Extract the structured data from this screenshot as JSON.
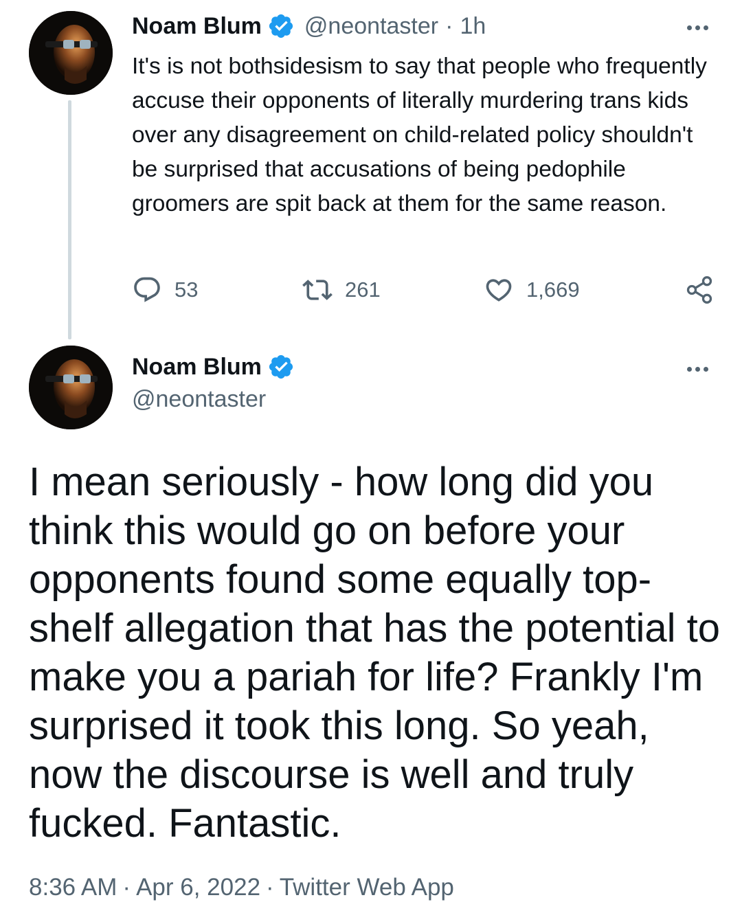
{
  "parent_tweet": {
    "author_name": "Noam Blum",
    "handle": "@neontaster",
    "separator": "·",
    "time_ago": "1h",
    "text": "It's is not bothsidesism to say that people who frequently accuse their opponents of literally murdering trans kids over any disagreement on child-related policy shouldn't be surprised that accusations of being pedophile groomers are spit back at them for the same reason.",
    "actions": {
      "reply_icon": "reply-icon",
      "replies": "53",
      "retweet_icon": "retweet-icon",
      "retweets": "261",
      "like_icon": "heart-icon",
      "likes": "1,669",
      "share_icon": "share-icon"
    }
  },
  "main_tweet": {
    "author_name": "Noam Blum",
    "handle": "@neontaster",
    "text": "I mean seriously - how long did you think this would go on before your opponents found some equally top-shelf allegation that has the potential to make you a pariah for life? Frankly I'm surprised it took this long. So yeah, now the discourse is well and truly fucked. Fantastic.",
    "time": "8:36 AM",
    "date": "Apr 6, 2022",
    "source": "Twitter Web App",
    "separator": "·"
  },
  "colors": {
    "verified_badge": "#1d9bf0",
    "secondary_text": "#536471",
    "primary_text": "#0f1419",
    "thread_line": "#cfd9de"
  }
}
